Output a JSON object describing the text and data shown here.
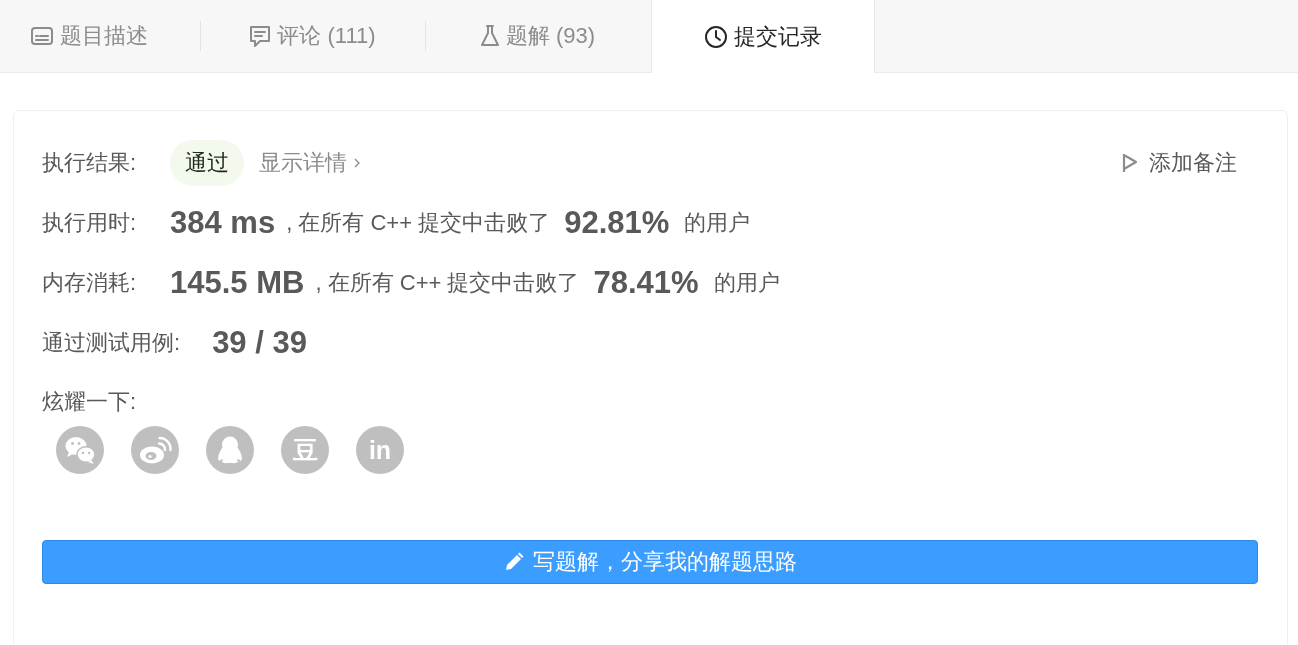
{
  "tabs": [
    {
      "label": "题目描述",
      "selected": false
    },
    {
      "label": "评论 (111)",
      "selected": false
    },
    {
      "label": "题解 (93)",
      "selected": false
    },
    {
      "label": "提交记录",
      "selected": true
    }
  ],
  "result": {
    "label": "执行结果:",
    "status": "通过",
    "details_link": "显示详情",
    "note_button": "添加备注"
  },
  "stats": [
    {
      "label": "执行用时:",
      "value": "384 ms",
      "comparison": ", 在所有 C++ 提交中击败了",
      "percent": "92.81%",
      "suffix": "的用户"
    },
    {
      "label": "内存消耗:",
      "value": "145.5 MB",
      "comparison": ", 在所有 C++ 提交中击败了",
      "percent": "78.41%",
      "suffix": "的用户"
    }
  ],
  "test_cases": {
    "label": "通过测试用例:",
    "value": "39 / 39"
  },
  "share": {
    "label": "炫耀一下:",
    "items": [
      {
        "kind": "bubbles"
      },
      {
        "kind": "swirl"
      },
      {
        "kind": "penguin"
      },
      {
        "kind": "glyph",
        "glyph": "豆"
      },
      {
        "kind": "glyph",
        "glyph": "in"
      }
    ]
  },
  "solution_button": {
    "label": "写题解，分享我的解题思路"
  }
}
